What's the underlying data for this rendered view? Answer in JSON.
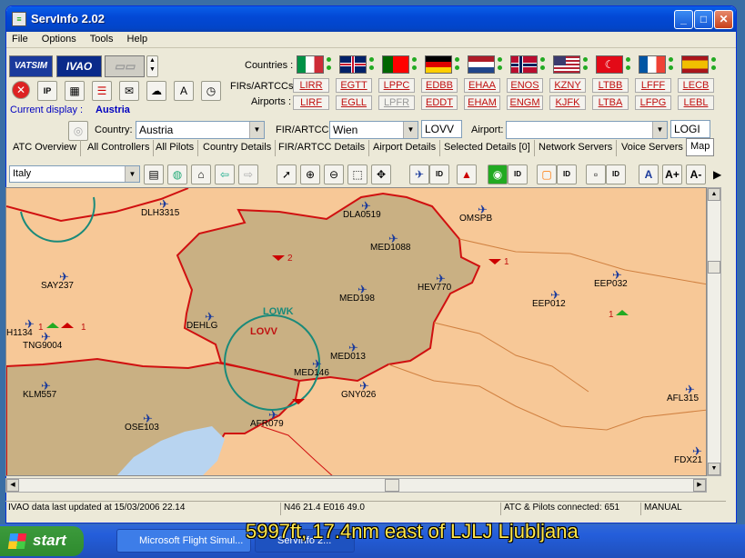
{
  "window": {
    "title": "ServInfo 2.02"
  },
  "menu": [
    "File",
    "Options",
    "Tools",
    "Help"
  ],
  "logos": {
    "vatsim": "VATSIM",
    "ivao": "IVAO"
  },
  "labels": {
    "countries": "Countries :",
    "firs": "FIRs/ARTCCs:",
    "airports": "Airports :",
    "current_display": "Current display :",
    "current_display_value": "Austria",
    "country": "Country:",
    "fir": "FIR/ARTCC:",
    "airport": "Airport:"
  },
  "country_flags": [
    "Italy",
    "United Kingdom",
    "Portugal",
    "Germany",
    "Netherlands",
    "Norway",
    "USA",
    "Turkey",
    "France",
    "Spain"
  ],
  "firs": [
    "LIRR",
    "EGTT",
    "LPPC",
    "EDBB",
    "EHAA",
    "ENOS",
    "KZNY",
    "LTBB",
    "LFFF",
    "LECB"
  ],
  "airports": [
    "LIRF",
    "EGLL",
    "LPFR",
    "EDDT",
    "EHAM",
    "ENGM",
    "KJFK",
    "LTBA",
    "LFPG",
    "LEBL"
  ],
  "selectors": {
    "country_value": "Austria",
    "fir_value": "Wien",
    "fir_code": "LOVV",
    "airport_value": "",
    "airport_code": "LOGI"
  },
  "tabs": [
    "ATC Overview",
    "All Controllers",
    "All Pilots",
    "Country Details",
    "FIR/ARTCC Details",
    "Airport Details",
    "Selected Details [0]",
    "Network Servers",
    "Voice Servers",
    "Map"
  ],
  "map_region": "Italy",
  "map": {
    "atc_labels": [
      "LOWK",
      "LOVV"
    ],
    "atc_counts": [
      "2",
      "1",
      "1",
      "1",
      "1"
    ],
    "aircraft": [
      "DLH3315",
      "DLA0519",
      "OMSPB",
      "MED1088",
      "SAY237",
      "HEV770",
      "EEP032",
      "EEP012",
      "MED198",
      "DEHLG",
      "H1134",
      "TNG9004",
      "MED013",
      "MED146",
      "KLM557",
      "GNY026",
      "AFL315",
      "OSE103",
      "AFR079",
      "FDX21"
    ]
  },
  "status": {
    "updated": "IVAO data last updated at 15/03/2006 22.14",
    "position": "N46 21.4   E016 49.0",
    "connected": "ATC & Pilots connected: 651",
    "mode": "MANUAL"
  },
  "taskbar": {
    "start": "start",
    "tasks": [
      "Microsoft Flight Simul...",
      "ServInfo 2..."
    ]
  },
  "overlay_text": "5997ft, 17.4nm east of LJLJ Ljubljana"
}
